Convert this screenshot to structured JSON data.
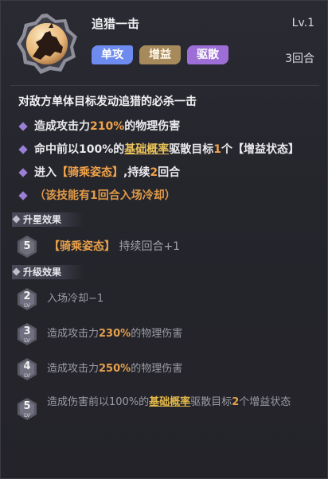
{
  "skill": {
    "name": "追猎一击",
    "level": "Lv.1",
    "cooldown": "3回合",
    "tags": [
      "单攻",
      "增益",
      "驱散"
    ],
    "description": "对敌方单体目标发动追猎的必杀一击",
    "icon": "mounted-knight-icon"
  },
  "effects": {
    "e1_pre": "造成攻击力",
    "e1_val": "210%",
    "e1_post": "的物理伤害",
    "e2_pre": "命中前以100%的",
    "e2_hl": "基础概率",
    "e2_mid": "驱散目标",
    "e2_num": "1",
    "e2_post": "个【增益状态】",
    "e3_pre": "进入",
    "e3_hl": "【骑乘姿态】",
    "e3_mid": ",持续",
    "e3_num": "2",
    "e3_post": "回合",
    "e4": "（该技能有1回合入场冷却）"
  },
  "star_section": {
    "title": "升星效果",
    "star": "5",
    "hl": "【骑乘姿态】",
    "text": "持续回合+1"
  },
  "upgrade_section": {
    "title": "升级效果",
    "lv_label": "LV",
    "rows": [
      {
        "lv": "2",
        "text": "入场冷却−1"
      },
      {
        "lv": "3",
        "pre": "造成攻击力",
        "val": "230%",
        "post": "的物理伤害"
      },
      {
        "lv": "4",
        "pre": "造成攻击力",
        "val": "250%",
        "post": "的物理伤害"
      },
      {
        "lv": "5",
        "pre": "造成伤害前以100%的",
        "hl": "基础概率",
        "mid": "驱散目标",
        "num": "2",
        "post": "个增益状态"
      }
    ]
  },
  "colors": {
    "accent_orange": "#f0a24a",
    "accent_yellow": "#e9c35a",
    "tag_blue": "#6e8cf0",
    "tag_tan": "#a78a5c",
    "tag_purple": "#9d6fd6"
  }
}
